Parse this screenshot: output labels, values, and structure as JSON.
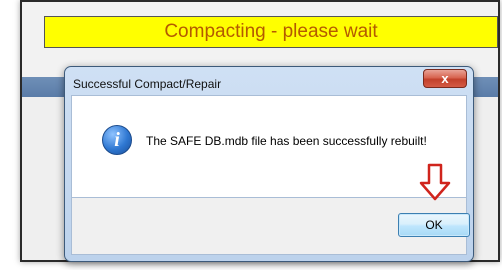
{
  "background_window": {
    "banner_text": "Compacting - please wait"
  },
  "dialog": {
    "title": "Successful Compact/Repair",
    "close_label": "x",
    "icon": "info-icon",
    "icon_glyph": "i",
    "message": "The SAFE DB.mdb file has been successfully rebuilt!",
    "ok_label": "OK",
    "annotation_icon": "down-arrow-icon"
  },
  "colors": {
    "banner_bg": "#ffff00",
    "banner_text": "#b45a00",
    "close_button": "#d45a45",
    "annotation_arrow": "#d0241c"
  }
}
